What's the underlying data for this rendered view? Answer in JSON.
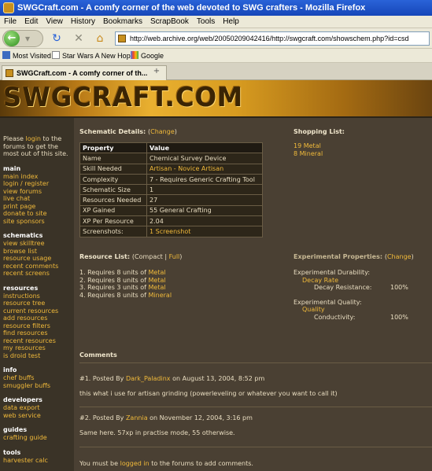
{
  "window": {
    "title": "SWGCraft.com - A comfy corner of the web devoted to SWG crafters - Mozilla Firefox"
  },
  "menu": [
    "File",
    "Edit",
    "View",
    "History",
    "Bookmarks",
    "ScrapBook",
    "Tools",
    "Help"
  ],
  "nav": {
    "url": "http://web.archive.org/web/20050209042416/http://swgcraft.com/showschem.php?id=csd"
  },
  "bookmarks": [
    "Most Visited",
    "Star Wars A New Hope",
    "Google"
  ],
  "tab": {
    "title": "SWGCraft.com - A comfy corner of th...",
    "new_tab": "+"
  },
  "site": {
    "logo": "SWGCRAFT.COM"
  },
  "sidebar": {
    "intro_pre": "Please ",
    "intro_link": "login",
    "intro_post": " to the forums to get the most out of this site.",
    "sections": [
      {
        "title": "main",
        "items": [
          "main index",
          "login / register",
          "view forums",
          "live chat",
          "print page",
          "donate to site",
          "site sponsors"
        ]
      },
      {
        "title": "schematics",
        "items": [
          "view skilltree",
          "browse list",
          "resource usage",
          "recent comments",
          "recent screens"
        ]
      },
      {
        "title": "resources",
        "items": [
          "instructions",
          "resource tree",
          "current resources",
          "add resources",
          "resource filters",
          "find resources",
          "recent resources",
          "my resources",
          "is droid test"
        ]
      },
      {
        "title": "info",
        "items": [
          "chef buffs",
          "smuggler buffs"
        ]
      },
      {
        "title": "developers",
        "items": [
          "data export",
          "web service"
        ]
      },
      {
        "title": "guides",
        "items": [
          "crafting guide"
        ]
      },
      {
        "title": "tools",
        "items": [
          "harvester calc"
        ]
      }
    ]
  },
  "schematic": {
    "title": "Schematic Details:",
    "change": "Change",
    "headers": [
      "Property",
      "Value"
    ],
    "rows": [
      {
        "property": "Name",
        "value": "Chemical Survey Device",
        "link": false
      },
      {
        "property": "Skill Needed",
        "value": "Artisan - Novice Artisan",
        "link": true
      },
      {
        "property": "Complexity",
        "value": "7 - Requires Generic Crafting Tool",
        "link": false
      },
      {
        "property": "Schematic Size",
        "value": "1",
        "link": false
      },
      {
        "property": "Resources Needed",
        "value": "27",
        "link": false
      },
      {
        "property": "XP Gained",
        "value": "55 General Crafting",
        "link": false
      },
      {
        "property": "XP Per Resource",
        "value": "2.04",
        "link": false
      },
      {
        "property": "Screenshots:",
        "value": "1 Screenshot",
        "link": true
      }
    ]
  },
  "shopping": {
    "title": "Shopping List:",
    "items": [
      {
        "qty": "19",
        "name": "Metal"
      },
      {
        "qty": "8",
        "name": "Mineral"
      }
    ]
  },
  "resources": {
    "title": "Resource List:",
    "compact": "Compact",
    "sep": "|",
    "full": "Full",
    "items": [
      {
        "text": "1. Requires 8 units of",
        "res": "Metal"
      },
      {
        "text": "2. Requires 8 units of",
        "res": "Metal"
      },
      {
        "text": "3. Requires 3 units of",
        "res": "Metal"
      },
      {
        "text": "4. Requires 8 units of",
        "res": "Mineral"
      }
    ]
  },
  "experimental": {
    "title": "Experimental Properties:",
    "change": "Change",
    "groups": [
      {
        "name": "Experimental Durability:",
        "sub": "Decay Rate",
        "attr": "Decay Resistance:",
        "val": "100%"
      },
      {
        "name": "Experimental Quality:",
        "sub": "Quality",
        "attr": "Conductivity:",
        "val": "100%"
      }
    ]
  },
  "comments": {
    "title": "Comments",
    "items": [
      {
        "num": "#1.",
        "posted_by": "Posted By",
        "author": "Dark_Paladinx",
        "on": "on August 13, 2004, 8:52 pm",
        "body": "this what i use for artisan grinding (powerleveling or whatever you want to call it)"
      },
      {
        "num": "#2.",
        "posted_by": "Posted By",
        "author": "Zannia",
        "on": "on November 12, 2004, 3:16 pm",
        "body": "Same here. 57xp in practise mode, 55 otherwise."
      }
    ],
    "footer_pre": "You must be",
    "footer_link": "logged in",
    "footer_post": "to the forums to add comments."
  }
}
